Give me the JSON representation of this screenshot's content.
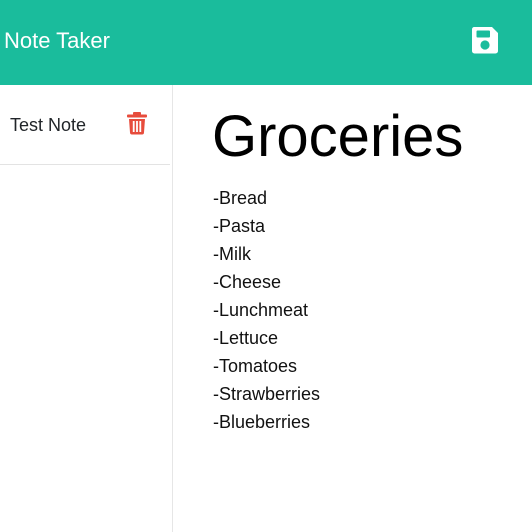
{
  "navbar": {
    "brand": "Note Taker",
    "save_icon": "save-icon",
    "background_color": "#1abc9c"
  },
  "sidebar": {
    "notes": [
      {
        "title": "Test Note",
        "delete_icon": "trash-icon",
        "delete_color": "#e74c3c"
      }
    ]
  },
  "editor": {
    "title": "Groceries",
    "body_lines": [
      "-Bread",
      "-Pasta",
      "-Milk",
      "-Cheese",
      "-Lunchmeat",
      "-Lettuce",
      "-Tomatoes",
      "-Strawberries",
      "-Blueberries"
    ]
  }
}
